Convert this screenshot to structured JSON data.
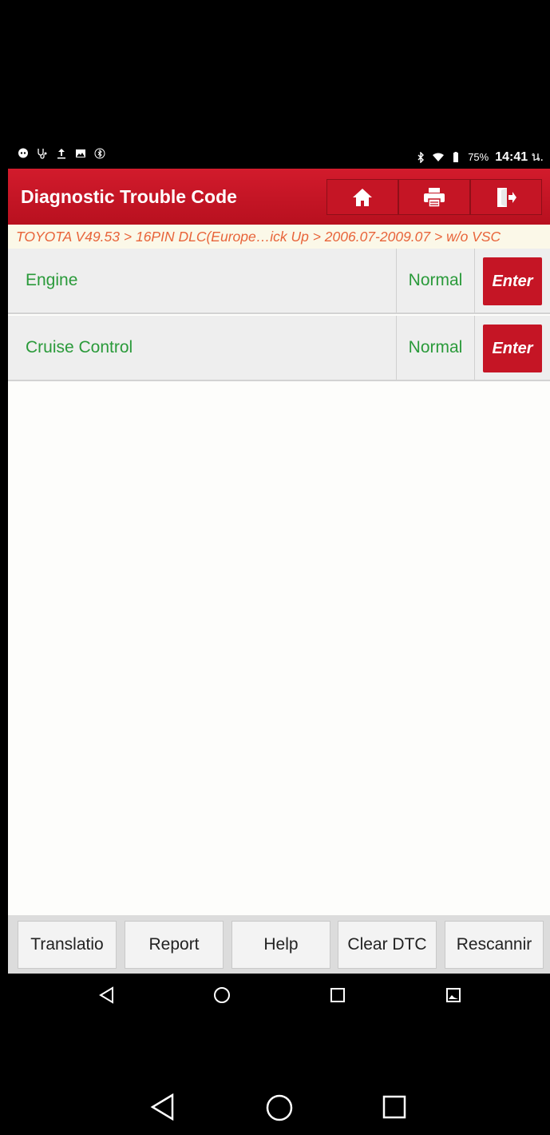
{
  "status_bar": {
    "battery": "75%",
    "time": "14:41",
    "time_suffix": "น."
  },
  "header": {
    "title": "Diagnostic Trouble Code",
    "buttons": [
      "home-icon",
      "print-icon",
      "exit-icon"
    ]
  },
  "breadcrumb": "TOYOTA V49.53 > 16PIN DLC(Europe…ick Up > 2006.07-2009.07 > w/o VSC",
  "systems": [
    {
      "name": "Engine",
      "status": "Normal",
      "action": "Enter"
    },
    {
      "name": "Cruise Control",
      "status": "Normal",
      "action": "Enter"
    }
  ],
  "bottom_buttons": [
    "Translatio",
    "Report",
    "Help",
    "Clear DTC",
    "Rescannir"
  ],
  "colors": {
    "header_red": "#c81626",
    "status_green": "#2a9a3a",
    "breadcrumb_orange": "#e8643a"
  }
}
